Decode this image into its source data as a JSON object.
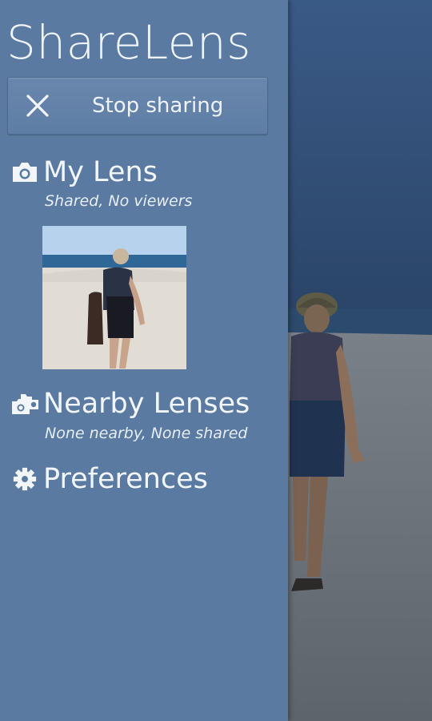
{
  "app": {
    "title": "ShareLens"
  },
  "stop_button": {
    "label": "Stop sharing",
    "icon": "close-icon"
  },
  "sections": {
    "my_lens": {
      "title": "My Lens",
      "status": "Shared, No viewers",
      "icon": "camera-icon"
    },
    "nearby": {
      "title": "Nearby Lenses",
      "status": "None nearby, None shared",
      "icon": "cameras-icon"
    },
    "preferences": {
      "title": "Preferences",
      "icon": "gear-icon"
    }
  },
  "colors": {
    "drawer_bg": "#5a7aa1",
    "text": "#f2f6fa",
    "sky": "#2d4468",
    "sea": "#25405e",
    "sand": "#6e757c"
  }
}
